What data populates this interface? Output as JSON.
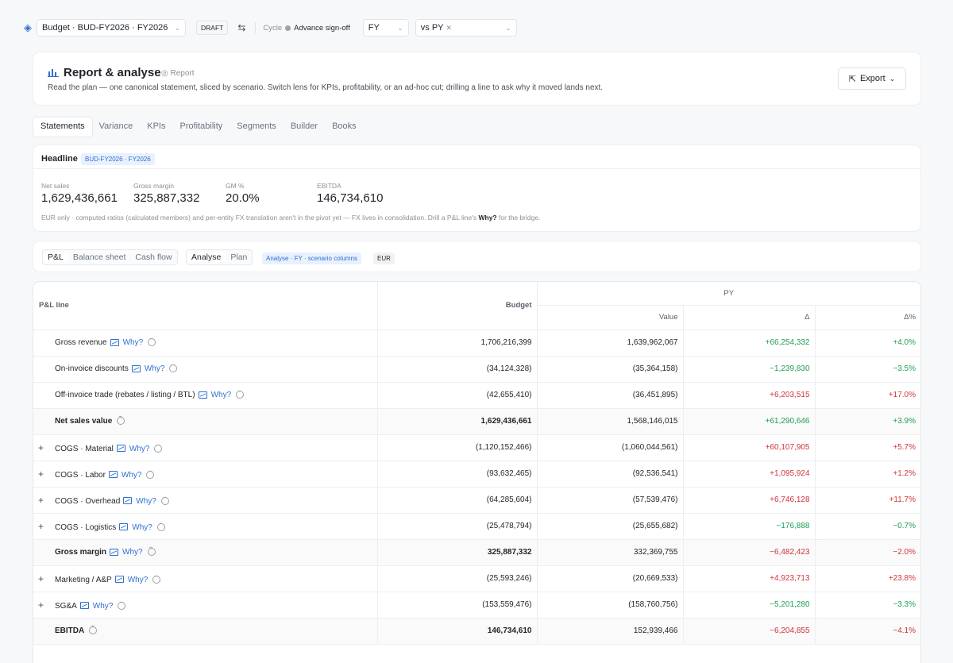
{
  "topbar": {
    "budget_select": "Budget · BUD-FY2026 · FY2026",
    "status_badge": "DRAFT",
    "cycle_label": "Cycle",
    "cycle_value": "Advance sign-off",
    "period_select": "FY",
    "compare_select": "vs PY"
  },
  "header": {
    "title": "Report & analyse",
    "subtitle": "Report",
    "description": "Read the plan — one canonical statement, sliced by scenario. Switch lens for KPIs, profitability, or an ad-hoc cut; drilling a line to ask why it moved lands next.",
    "export_label": "Export"
  },
  "tabs": [
    "Statements",
    "Variance",
    "KPIs",
    "Profitability",
    "Segments",
    "Builder",
    "Books"
  ],
  "headline": {
    "label": "Headline",
    "tag": "BUD-FY2026 · FY2026",
    "kpis": [
      {
        "label": "Net sales",
        "value": "1,629,436,661"
      },
      {
        "label": "Gross margin",
        "value": "325,887,332"
      },
      {
        "label": "GM %",
        "value": "20.0%"
      },
      {
        "label": "EBITDA",
        "value": "146,734,610"
      }
    ],
    "note_prefix": "EUR only · computed ratios (calculated members) and per-entity FX translation aren't in the pivot yet — FX lives in consolidation. Drill a P&L line's ",
    "note_bold": "Why?",
    "note_suffix": " for the bridge."
  },
  "lens": {
    "statements": [
      "P&L",
      "Balance sheet",
      "Cash flow"
    ],
    "modes": [
      "Analyse",
      "Plan"
    ],
    "scenario_tag": "Analyse · FY · scenario columns",
    "currency_tag": "EUR"
  },
  "table": {
    "col_line": "P&L line",
    "col_budget": "Budget",
    "col_group": "PY",
    "col_value": "Value",
    "col_delta": "Δ",
    "col_delta_pct": "Δ%",
    "why_label": "Why?",
    "rows": [
      {
        "label": "Gross revenue",
        "budget": "1,706,216,399",
        "value": "1,639,962,067",
        "delta": "+66,254,332",
        "pct": "+4.0%",
        "dtone": "pos",
        "ptone": "pos",
        "expand": false,
        "total": false,
        "trend": true
      },
      {
        "label": "On-invoice discounts",
        "budget": "(34,124,328)",
        "value": "(35,364,158)",
        "delta": "−1,239,830",
        "pct": "−3.5%",
        "dtone": "pos",
        "ptone": "pos",
        "expand": false,
        "total": false,
        "trend": true
      },
      {
        "label": "Off-invoice trade (rebates / listing / BTL)",
        "budget": "(42,655,410)",
        "value": "(36,451,895)",
        "delta": "+6,203,515",
        "pct": "+17.0%",
        "dtone": "neg",
        "ptone": "neg",
        "expand": false,
        "total": false,
        "trend": true
      },
      {
        "label": "Net sales value",
        "budget": "1,629,436,661",
        "value": "1,568,146,015",
        "delta": "+61,290,646",
        "pct": "+3.9%",
        "dtone": "pos",
        "ptone": "pos",
        "expand": false,
        "total": true,
        "trend": false
      },
      {
        "label": "COGS · Material",
        "budget": "(1,120,152,466)",
        "value": "(1,060,044,561)",
        "delta": "+60,107,905",
        "pct": "+5.7%",
        "dtone": "neg",
        "ptone": "neg",
        "expand": true,
        "total": false,
        "trend": true
      },
      {
        "label": "COGS · Labor",
        "budget": "(93,632,465)",
        "value": "(92,536,541)",
        "delta": "+1,095,924",
        "pct": "+1.2%",
        "dtone": "neg",
        "ptone": "neg",
        "expand": true,
        "total": false,
        "trend": true
      },
      {
        "label": "COGS · Overhead",
        "budget": "(64,285,604)",
        "value": "(57,539,476)",
        "delta": "+6,746,128",
        "pct": "+11.7%",
        "dtone": "neg",
        "ptone": "neg",
        "expand": true,
        "total": false,
        "trend": true
      },
      {
        "label": "COGS · Logistics",
        "budget": "(25,478,794)",
        "value": "(25,655,682)",
        "delta": "−176,888",
        "pct": "−0.7%",
        "dtone": "pos",
        "ptone": "pos",
        "expand": true,
        "total": false,
        "trend": true
      },
      {
        "label": "Gross margin",
        "budget": "325,887,332",
        "value": "332,369,755",
        "delta": "−6,482,423",
        "pct": "−2.0%",
        "dtone": "neg",
        "ptone": "neg",
        "expand": false,
        "total": true,
        "trend": true
      },
      {
        "label": "Marketing / A&P",
        "budget": "(25,593,246)",
        "value": "(20,669,533)",
        "delta": "+4,923,713",
        "pct": "+23.8%",
        "dtone": "neg",
        "ptone": "neg",
        "expand": true,
        "total": false,
        "trend": true
      },
      {
        "label": "SG&A",
        "budget": "(153,559,476)",
        "value": "(158,760,756)",
        "delta": "−5,201,280",
        "pct": "−3.3%",
        "dtone": "pos",
        "ptone": "pos",
        "expand": true,
        "total": false,
        "trend": true
      },
      {
        "label": "EBITDA",
        "budget": "146,734,610",
        "value": "152,939,466",
        "delta": "−6,204,855",
        "pct": "−4.1%",
        "dtone": "neg",
        "ptone": "neg",
        "expand": false,
        "total": true,
        "trend": false
      }
    ]
  },
  "colors": {
    "accent": "#2f6fd0",
    "positive": "#1f9d55",
    "negative": "#d0343a"
  }
}
